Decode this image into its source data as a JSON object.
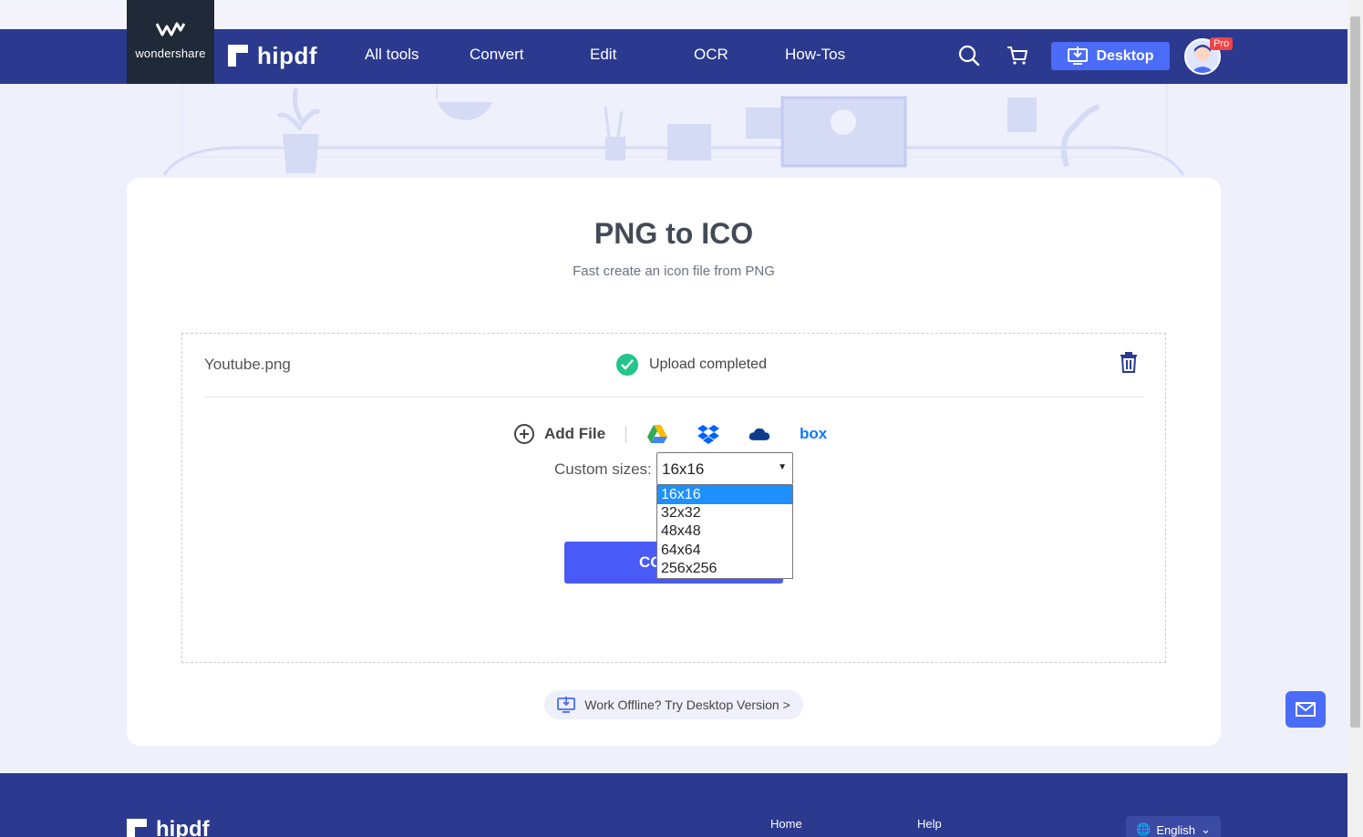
{
  "header": {
    "wondershare_label": "wondershare",
    "brand_name": "hipdf",
    "nav": [
      "All tools",
      "Convert",
      "Edit",
      "OCR",
      "How-Tos"
    ],
    "desktop_button": "Desktop",
    "pro_badge": "Pro",
    "icons": [
      "search-icon",
      "cart-icon",
      "download-icon",
      "avatar"
    ],
    "colors": {
      "navbar": "#2b3a8f",
      "accent": "#4a6cf7"
    }
  },
  "tool": {
    "title": "PNG to ICO",
    "subtitle": "Fast create an icon file from PNG"
  },
  "file": {
    "name": "Youtube.png",
    "status": "Upload completed"
  },
  "add_file": {
    "label": "Add File",
    "sources": [
      "google-drive-icon",
      "dropbox-icon",
      "onedrive-icon",
      "box-icon"
    ],
    "box_label": "box"
  },
  "options": {
    "label": "Custom sizes:",
    "selected": "16x16",
    "choices": [
      "16x16",
      "32x32",
      "48x48",
      "64x64",
      "256x256"
    ]
  },
  "convert_button": "CO",
  "offline": "Work Offline? Try Desktop Version >",
  "footer": {
    "brand": "hipdf",
    "links": [
      "Home",
      "Help"
    ],
    "language": "English"
  }
}
